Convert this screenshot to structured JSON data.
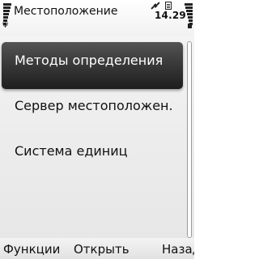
{
  "status_bar": {
    "title": "Местоположение",
    "time": "14.29",
    "signal_strength": 7,
    "battery_level": 7,
    "icons": [
      "signal-strength-icon",
      "antenna-icon",
      "gps-satellite-icon",
      "messaging-icon",
      "battery-level-icon",
      "charger-icon"
    ]
  },
  "list": {
    "items": [
      {
        "label": "Методы определения",
        "selected": true
      },
      {
        "label": "Сервер местоположен.",
        "selected": false
      },
      {
        "label": "Система единиц",
        "selected": false
      }
    ]
  },
  "softkeys": {
    "left": "Функции",
    "middle": "Открыть",
    "right": "Назад"
  },
  "colors": {
    "selection_dark": "#1e1e1e",
    "selection_light": "#545454",
    "background": "#ececec",
    "text": "#111111",
    "selected_text": "#ffffff"
  }
}
